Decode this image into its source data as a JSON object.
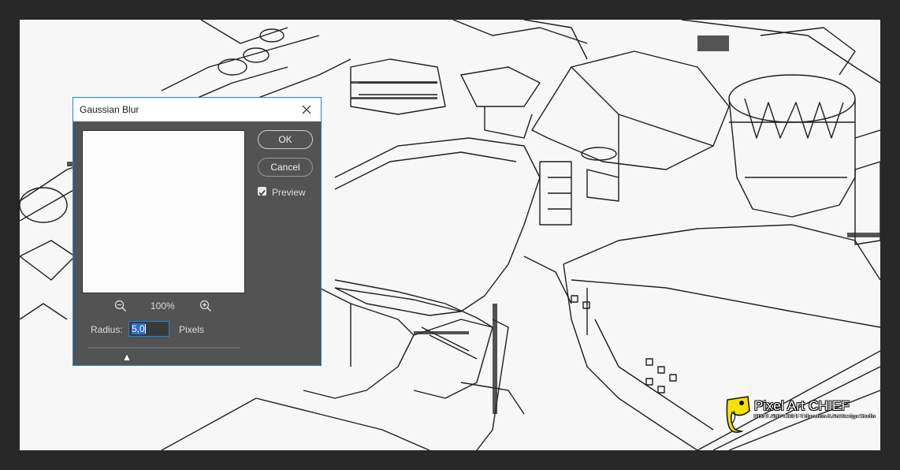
{
  "dialog": {
    "title": "Gaussian Blur",
    "ok_label": "OK",
    "cancel_label": "Cancel",
    "preview_label": "Preview",
    "preview_checked": true,
    "zoom_level": "100%",
    "radius_label": "Radius:",
    "radius_value": "5,0",
    "radius_unit": "Pixels",
    "slider_fraction": 0.26,
    "accent_color": "#1c87d6"
  },
  "icons": {
    "close": "close-icon",
    "zoom_out": "zoom-out-icon",
    "zoom_in": "zoom-in-icon",
    "checkbox": "checkmark-icon",
    "slider": "slider-triangle-icon"
  },
  "watermark": {
    "title": "Pixel Art CHIEF",
    "subtitle": "PIXEL ART CHIEF Education & Art Design Studio"
  },
  "colors": {
    "workspace": "#282828",
    "dialog_bg": "#535353",
    "canvas_bg": "#f7f7f7"
  }
}
